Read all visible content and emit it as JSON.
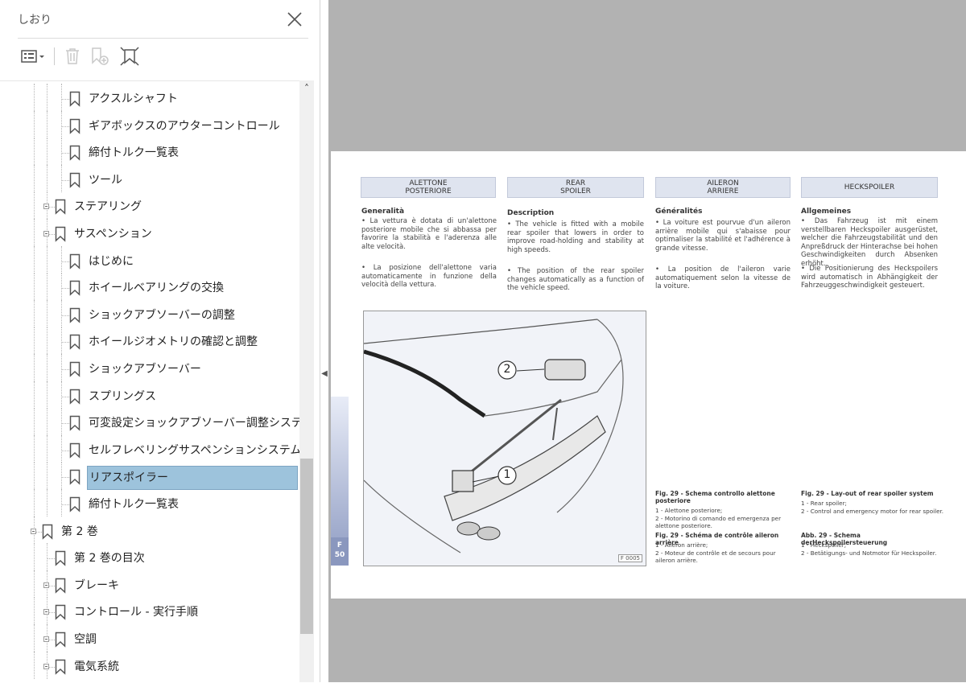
{
  "panel": {
    "title": "しおり",
    "tree": [
      {
        "label": "アクスルシャフト",
        "level": 2
      },
      {
        "label": "ギアボックスのアウターコントロール",
        "level": 2
      },
      {
        "label": "締付トルク一覧表",
        "level": 2
      },
      {
        "label": "ツール",
        "level": 2
      },
      {
        "label": "ステアリング",
        "level": 1,
        "expandable": true
      },
      {
        "label": "サスペンション",
        "level": 1,
        "expandable": true
      },
      {
        "label": "はじめに",
        "level": 2
      },
      {
        "label": "ホイールベアリングの交換",
        "level": 2
      },
      {
        "label": "ショックアブソーバーの調整",
        "level": 2
      },
      {
        "label": "ホイールジオメトリの確認と調整",
        "level": 2
      },
      {
        "label": "ショックアブソーバー",
        "level": 2
      },
      {
        "label": "スプリングス",
        "level": 2
      },
      {
        "label": "可変設定ショックアブソーバー調整システム",
        "level": 2
      },
      {
        "label": "セルフレベリングサスペンションシステム",
        "level": 2
      },
      {
        "label": "リアスポイラー",
        "level": 2,
        "selected": true
      },
      {
        "label": "締付トルク一覧表",
        "level": 2
      },
      {
        "label": "第 2 巻",
        "level": 0,
        "expandable": true
      },
      {
        "label": "第 2 巻の目次",
        "level": 1
      },
      {
        "label": "ブレーキ",
        "level": 1,
        "expandable": true
      },
      {
        "label": "コントロール - 実行手順",
        "level": 1,
        "expandable": true
      },
      {
        "label": "空調",
        "level": 1,
        "expandable": true
      },
      {
        "label": "電気系統",
        "level": 1,
        "expandable": true
      }
    ]
  },
  "page": {
    "columns": [
      {
        "header": "ALETTONE\nPOSTERIORE",
        "section": "Generalità",
        "p1": "• La vettura è dotata di un'alettone posteriore mobile che si abbassa per favorire la stabilità e l'aderenza alle alte velocità.",
        "p2": "• La posizione dell'alettone varia automaticamente in funzione della velocità della vettura."
      },
      {
        "header": "REAR\nSPOILER",
        "section": "Description",
        "p1": "• The vehicle is fitted with a mobile rear spoiler that lowers in order to improve road-holding and stability at high speeds.",
        "p2": "• The position of the rear spoiler changes automatically as a function of the vehicle speed."
      },
      {
        "header": "AILERON\nARRIERE",
        "section": "Généralités",
        "p1": "• La voiture est pourvue d'un aileron arrière mobile qui s'abaisse pour optimaliser la stabilité et l'adhérence à grande vitesse.",
        "p2": "• La position de l'aileron varie automatiquement selon la vitesse de la voiture."
      },
      {
        "header": "HECKSPOILER",
        "section": "Allgemeines",
        "p1": "• Das Fahrzeug ist mit einem verstellbaren Heckspoiler ausgerüstet, welcher die Fahrzeugstabilität und den Anpreßdruck der Hinterachse bei hohen Geschwindigkeiten durch Absenken erhöht.",
        "p2": "• Die Positionierung des Heckspoilers wird automatisch in Abhängigkeit der Fahrzeuggeschwindigkeit gesteuert."
      }
    ],
    "figure": {
      "callout_1": "1",
      "callout_2": "2",
      "code": "F 0005",
      "page_letter": "F",
      "page_number": "50"
    },
    "captions": [
      {
        "title": "Fig. 29 - Schema controllo alettone posteriore",
        "lines": [
          "1 - Alettone posteriore;",
          "2 - Motorino di comando ed emergenza per alettone posteriore."
        ]
      },
      {
        "title": "Fig. 29 - Schéma de contrôle aileron arrière",
        "lines": [
          "1 - Aileron arrière;",
          "2 - Moteur de contrôle et de secours pour aileron arrière."
        ]
      },
      {
        "title": "Fig. 29 - Lay-out of rear spoiler system",
        "lines": [
          "1 - Rear spoiler;",
          "2 - Control and emergency motor for rear spoiler."
        ]
      },
      {
        "title": "Abb. 29 - Schema derHeckspoilersteuerung",
        "lines": [
          "1 - Heckspoiler;",
          "2 - Betätigungs- und Notmotor für Heckspoiler."
        ]
      }
    ]
  },
  "colors": {
    "selected_bg": "#9dc3dc",
    "viewer_bg": "#b2b2b2",
    "header_box": "#dfe4ef"
  },
  "icons": [
    "close-icon",
    "options-icon",
    "trash-icon",
    "new-bookmark-icon",
    "expand-bookmark-icon",
    "bookmark-icon"
  ]
}
